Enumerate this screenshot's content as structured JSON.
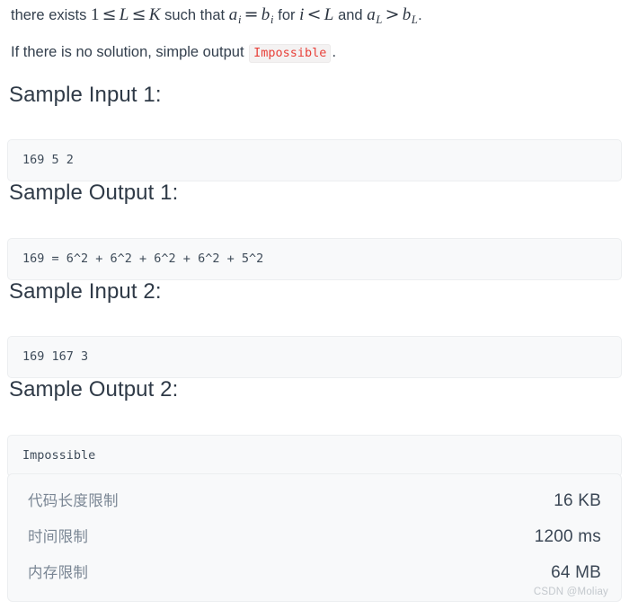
{
  "document": {
    "paragraph_1": {
      "lead": "there exists",
      "math_1": "1 ≤ L ≤ K",
      "math_1_parts": {
        "one": "1",
        "le_1": "≤",
        "L": "L",
        "le_2": "≤",
        "K": "K"
      },
      "mid_1": "such that",
      "math_2_parts": {
        "a": "a",
        "a_sub": "i",
        "eq": "=",
        "b": "b",
        "b_sub": "i"
      },
      "mid_2": "for",
      "math_3_parts": {
        "i": "i",
        "lt": "<",
        "L": "L"
      },
      "mid_3": "and",
      "math_4_parts": {
        "a": "a",
        "a_sub": "L",
        "gt": ">",
        "b": "b",
        "b_sub": "L"
      },
      "tail": "."
    },
    "paragraph_2": {
      "before_code": "If there is no solution, simple output",
      "code": "Impossible",
      "after_code": "."
    },
    "sections": [
      {
        "heading": "Sample Input 1:",
        "code": "169 5 2"
      },
      {
        "heading": "Sample Output 1:",
        "code": "169 = 6^2 + 6^2 + 6^2 + 6^2 + 5^2"
      },
      {
        "heading": "Sample Input 2:",
        "code": "169 167 3"
      },
      {
        "heading": "Sample Output 2:",
        "code": "Impossible"
      }
    ],
    "limits": {
      "rows": [
        {
          "label": "代码长度限制",
          "value": "16 KB"
        },
        {
          "label": "时间限制",
          "value": "1200 ms"
        },
        {
          "label": "内存限制",
          "value": "64 MB"
        }
      ]
    },
    "watermark": "CSDN @Moliay",
    "colors": {
      "text": "#34404e",
      "heading": "#2f3a47",
      "code_bg": "#f8f9fa",
      "code_border": "#eceef0",
      "code_text": "#3f4c5a",
      "inline_code_text": "#e8413a",
      "inline_code_bg": "#f4f2f2",
      "limit_label": "#7a8694",
      "limit_value": "#3b4755",
      "watermark": "#c3c8cd"
    }
  }
}
